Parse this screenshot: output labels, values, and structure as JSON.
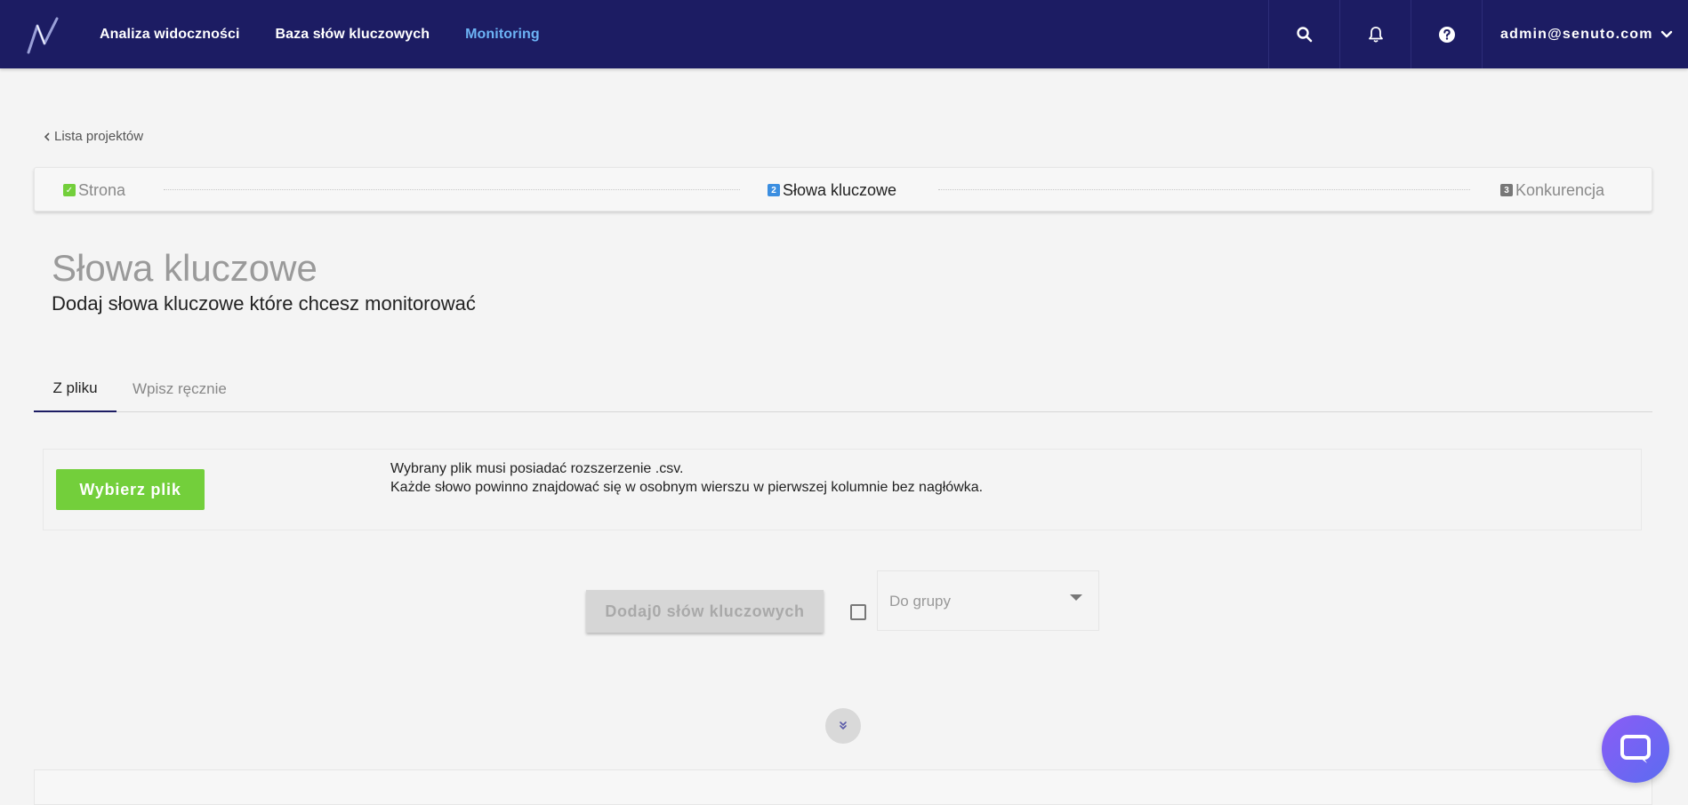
{
  "header": {
    "nav": [
      {
        "label": "Analiza widoczności",
        "active": false
      },
      {
        "label": "Baza słów kluczowych",
        "active": false
      },
      {
        "label": "Monitoring",
        "active": true
      }
    ],
    "user_email": "admin@senuto.com",
    "icons": [
      "search-icon",
      "bell-icon",
      "help-icon",
      "chevron-down-icon"
    ]
  },
  "breadcrumb": {
    "label": "Lista projektów"
  },
  "stepper": {
    "steps": [
      {
        "badge": "✓",
        "label": "Strona",
        "state": "done"
      },
      {
        "badge": "2",
        "label": "Słowa kluczowe",
        "state": "current"
      },
      {
        "badge": "3",
        "label": "Konkurencja",
        "state": "upcoming"
      }
    ]
  },
  "page": {
    "title": "Słowa kluczowe",
    "subtitle": "Dodaj słowa kluczowe które chcesz monitorować"
  },
  "tabs": [
    {
      "label": "Z pliku",
      "active": true
    },
    {
      "label": "Wpisz ręcznie",
      "active": false
    }
  ],
  "file_panel": {
    "button_label": "Wybierz plik",
    "info_line1": "Wybrany plik musi posiadać rozszerzenie .csv.",
    "info_line2": "Każde słowo powinno znajdować się w osobnym wierszu w pierwszej kolumnie bez nagłówka."
  },
  "actions": {
    "add_button_label": "Dodaj0 słów kluczowych",
    "group_checkbox_checked": false,
    "group_select_placeholder": "Do grupy"
  },
  "colors": {
    "topbar": "#1c1c63",
    "nav_active": "#6cb3f5",
    "success": "#73cf3b",
    "step_current": "#3b8ee0",
    "step_upcoming": "#777777",
    "chat_gradient_start": "#8b5cf6",
    "chat_gradient_end": "#5b6cf0"
  }
}
